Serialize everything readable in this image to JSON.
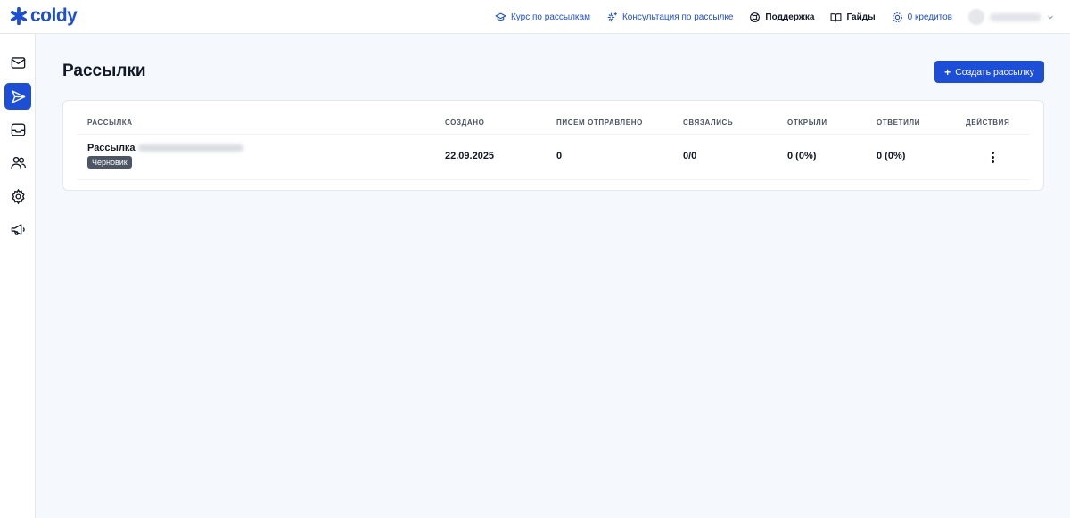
{
  "brand": {
    "name": "coldy",
    "color": "#1d4ed8"
  },
  "topnav": {
    "course": "Курс по рассылкам",
    "consult": "Консультация по рассылке",
    "support": "Поддержка",
    "guides": "Гайды",
    "credits": "0 кредитов"
  },
  "sidebar": {
    "items": [
      {
        "icon": "mail-icon",
        "active": false
      },
      {
        "icon": "send-icon",
        "active": true
      },
      {
        "icon": "inbox-icon",
        "active": false
      },
      {
        "icon": "users-icon",
        "active": false
      },
      {
        "icon": "gear-icon",
        "active": false
      },
      {
        "icon": "megaphone-icon",
        "active": false
      }
    ]
  },
  "page": {
    "title": "Рассылки",
    "create_button": "Создать рассылку",
    "create_plus": "+"
  },
  "table": {
    "columns": [
      "Рассылка",
      "Создано",
      "Писем отправлено",
      "Связались",
      "Открыли",
      "Ответили",
      "Действия"
    ],
    "rows": [
      {
        "name": "Рассылка",
        "status": "Черновик",
        "created": "22.09.2025",
        "sent": "0",
        "contacted": "0/0",
        "opened": "0 (0%)",
        "replied": "0 (0%)"
      }
    ]
  },
  "colors": {
    "accent": "#1d4ed8",
    "background": "#f5f8fc",
    "badge": "#4b5563"
  }
}
